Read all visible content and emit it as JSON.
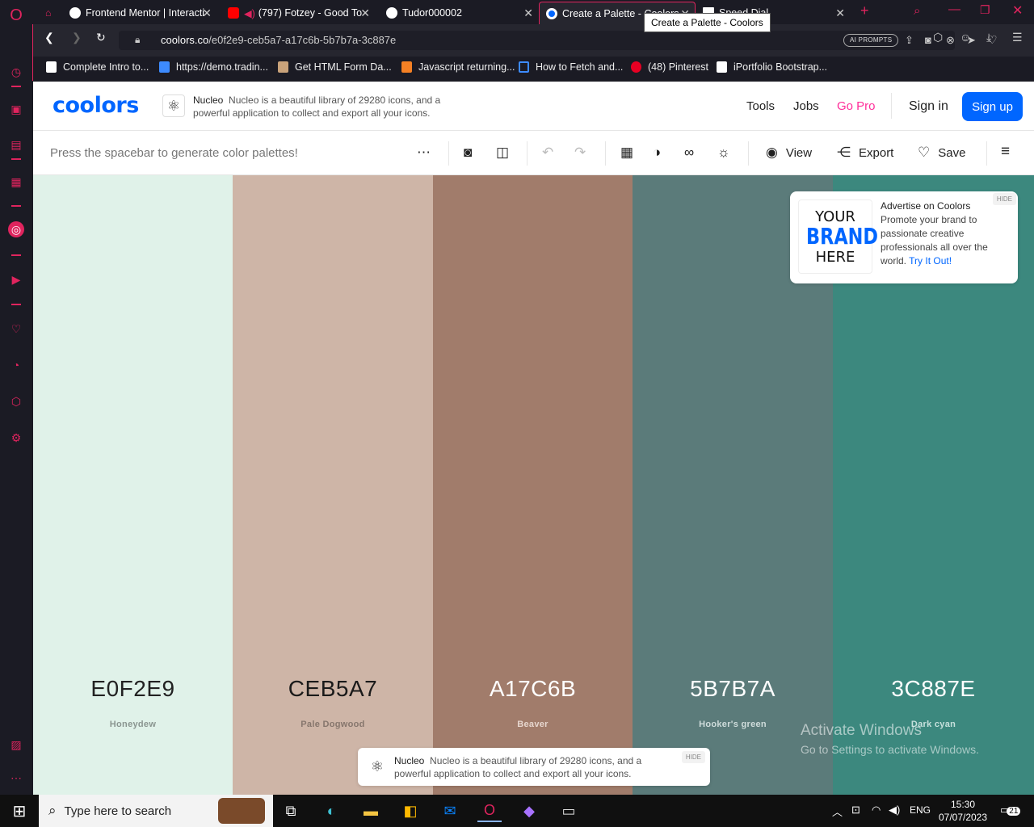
{
  "browser": {
    "tabs": [
      {
        "title": "Frontend Mentor | Interacti",
        "active": false
      },
      {
        "title": "(797) Fotzey - Good To",
        "active": false
      },
      {
        "title": "Tudor000002",
        "active": false
      },
      {
        "title": "Create a Palette - Coolors",
        "active": true
      },
      {
        "title": "Speed Dial",
        "active": false
      }
    ],
    "tooltip": "Create a Palette - Coolors",
    "url_domain": "coolors.co",
    "url_path": "/e0f2e9-ceb5a7-a17c6b-5b7b7a-3c887e",
    "ai_prompts": "AI PROMPTS",
    "bookmarks": [
      "Complete Intro to...",
      "https://demo.tradin...",
      "Get HTML Form Da...",
      "Javascript returning...",
      "How to Fetch and...",
      "(48) Pinterest",
      "iPortfolio Bootstrap..."
    ]
  },
  "header": {
    "logo": "coolors",
    "ad_brand": "Nucleo",
    "ad_text": "Nucleo is a beautiful library of 29280 icons, and a powerful application to collect and export all your icons.",
    "nav": {
      "tools": "Tools",
      "jobs": "Jobs",
      "gopro": "Go Pro",
      "signin": "Sign in",
      "signup": "Sign up"
    }
  },
  "toolbar": {
    "hint": "Press the spacebar to generate color palettes!",
    "view": "View",
    "export": "Export",
    "save": "Save"
  },
  "palette": [
    {
      "hex": "E0F2E9",
      "name": "Honeydew",
      "color": "#e0f2e9",
      "text_color": "#222222",
      "name_color": "#8a9590"
    },
    {
      "hex": "CEB5A7",
      "name": "Pale Dogwood",
      "color": "#ceb5a7",
      "text_color": "#1a1a1a",
      "name_color": "#86766d"
    },
    {
      "hex": "A17C6B",
      "name": "Beaver",
      "color": "#a17c6b",
      "text_color": "#ffffff",
      "name_color": "#e6d6ce"
    },
    {
      "hex": "5B7B7A",
      "name": "Hooker's green",
      "color": "#5b7b7a",
      "text_color": "#ffffff",
      "name_color": "#cfdcdb"
    },
    {
      "hex": "3C887E",
      "name": "Dark cyan",
      "color": "#3c887e",
      "text_color": "#ffffff",
      "name_color": "#c6e0dc"
    }
  ],
  "brand_ad": {
    "logo_your": "YOUR",
    "logo_brand": "BRAND",
    "logo_here": "HERE",
    "title": "Advertise on Coolors",
    "body": "Promote your brand to passionate creative professionals all over the world.",
    "link": "Try It Out!",
    "hide": "HIDE"
  },
  "bottom_ad": {
    "brand": "Nucleo",
    "text": "Nucleo is a beautiful library of 29280 icons, and a powerful application to collect and export all your icons.",
    "hide": "HIDE"
  },
  "activate_windows": {
    "title": "Activate Windows",
    "subtitle": "Go to Settings to activate Windows."
  },
  "taskbar": {
    "search_placeholder": "Type here to search",
    "language": "ENG",
    "time": "15:30",
    "date": "07/07/2023",
    "notifications": "21"
  }
}
